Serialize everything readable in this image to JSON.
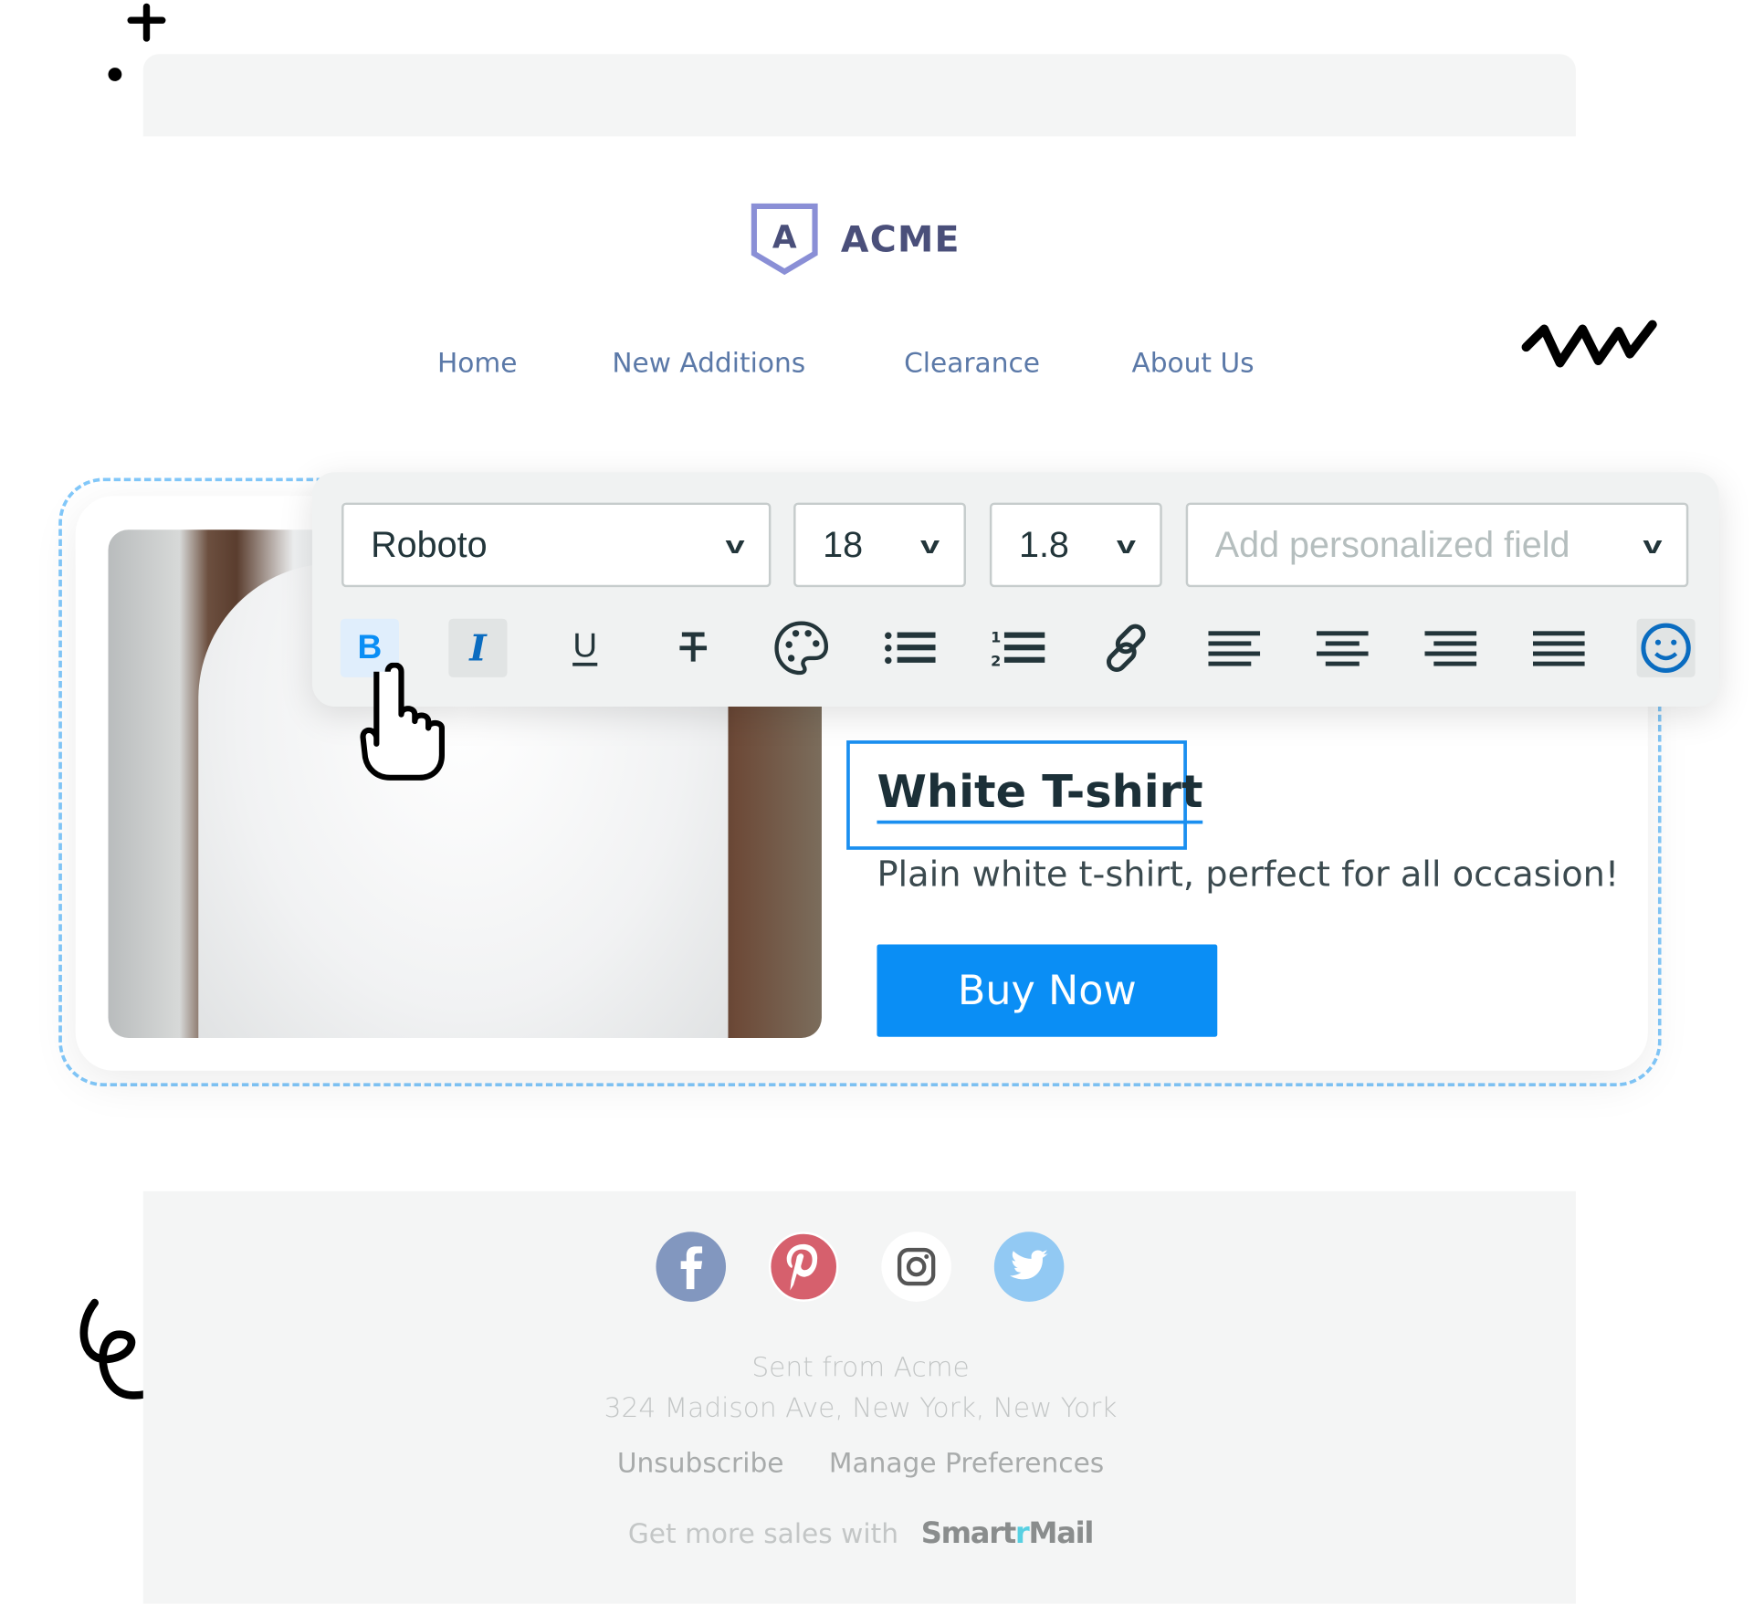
{
  "brand": {
    "name": "ACME",
    "logo_letter": "A"
  },
  "nav": {
    "items": [
      "Home",
      "New Additions",
      "Clearance",
      "About Us"
    ]
  },
  "toolbar": {
    "font": "Roboto",
    "size": "18",
    "line_height": "1.8",
    "personalized_placeholder": "Add personalized field",
    "buttons": [
      "bold",
      "italic",
      "underline",
      "strikethrough",
      "color-palette",
      "bullet-list",
      "numbered-list",
      "link",
      "align-left",
      "align-center",
      "align-right",
      "justify",
      "emoji"
    ],
    "bold_label": "B",
    "italic_label": "I",
    "underline_label": "U"
  },
  "product": {
    "title": "White T-shirt",
    "description": "Plain white t-shirt, perfect for all occasion!",
    "cta": "Buy Now"
  },
  "footer": {
    "social": [
      "facebook",
      "pinterest",
      "instagram",
      "twitter"
    ],
    "sent_from": "Sent from Acme",
    "address": "324 Madison Ave, New York, New York",
    "unsubscribe": "Unsubscribe",
    "manage": "Manage Preferences",
    "promo": "Get more sales with",
    "promo_brand_a": "Smart",
    "promo_brand_b": "r",
    "promo_brand_c": "Mail"
  },
  "colors": {
    "accent": "#0a8ef5",
    "nav": "#5b79a8",
    "facebook": "#8297bf",
    "pinterest": "#d6606d",
    "twitter": "#92c9f3"
  }
}
